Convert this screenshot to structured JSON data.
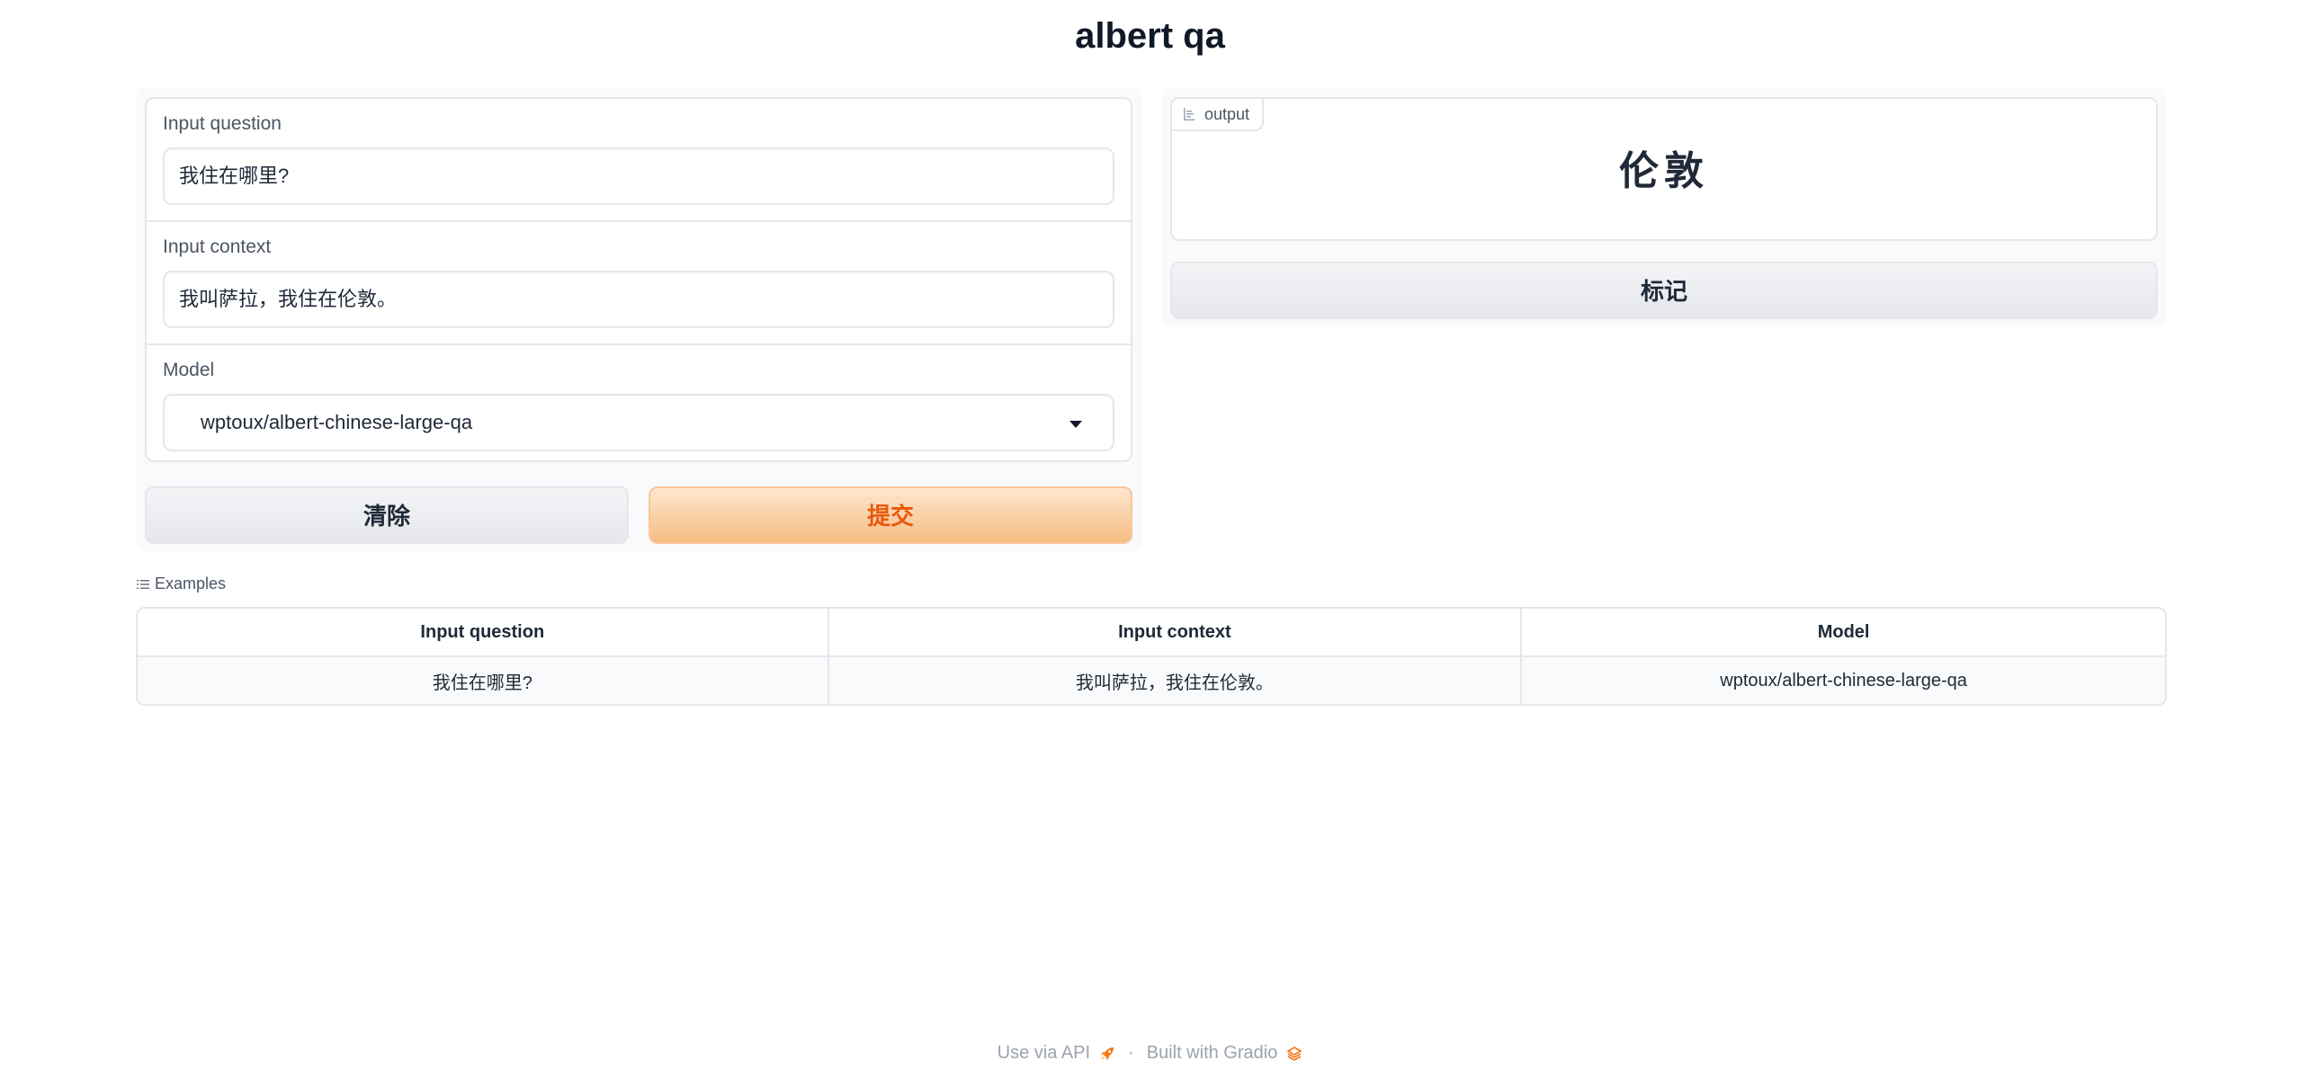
{
  "app": {
    "title": "albert qa"
  },
  "inputs": {
    "question": {
      "label": "Input question",
      "value": "我住在哪里?"
    },
    "context": {
      "label": "Input context",
      "value": "我叫萨拉，我住在伦敦。"
    },
    "model": {
      "label": "Model",
      "value": "wptoux/albert-chinese-large-qa"
    }
  },
  "actions": {
    "clear_label": "清除",
    "submit_label": "提交",
    "flag_label": "标记"
  },
  "output": {
    "label": "output",
    "value": "伦敦"
  },
  "examples": {
    "label": "Examples",
    "headers": [
      "Input question",
      "Input context",
      "Model"
    ],
    "rows": [
      [
        "我住在哪里?",
        "我叫萨拉，我住在伦敦。",
        "wptoux/albert-chinese-large-qa"
      ]
    ]
  },
  "footer": {
    "api_label": "Use via API",
    "separator": "·",
    "built_label": "Built with Gradio"
  },
  "colors": {
    "accent": "#ea580c",
    "submit_bg_top": "#fde7cf",
    "submit_bg_bottom": "#f6bd83",
    "border": "#e5e7eb",
    "panel_bg": "#f9fafb"
  }
}
